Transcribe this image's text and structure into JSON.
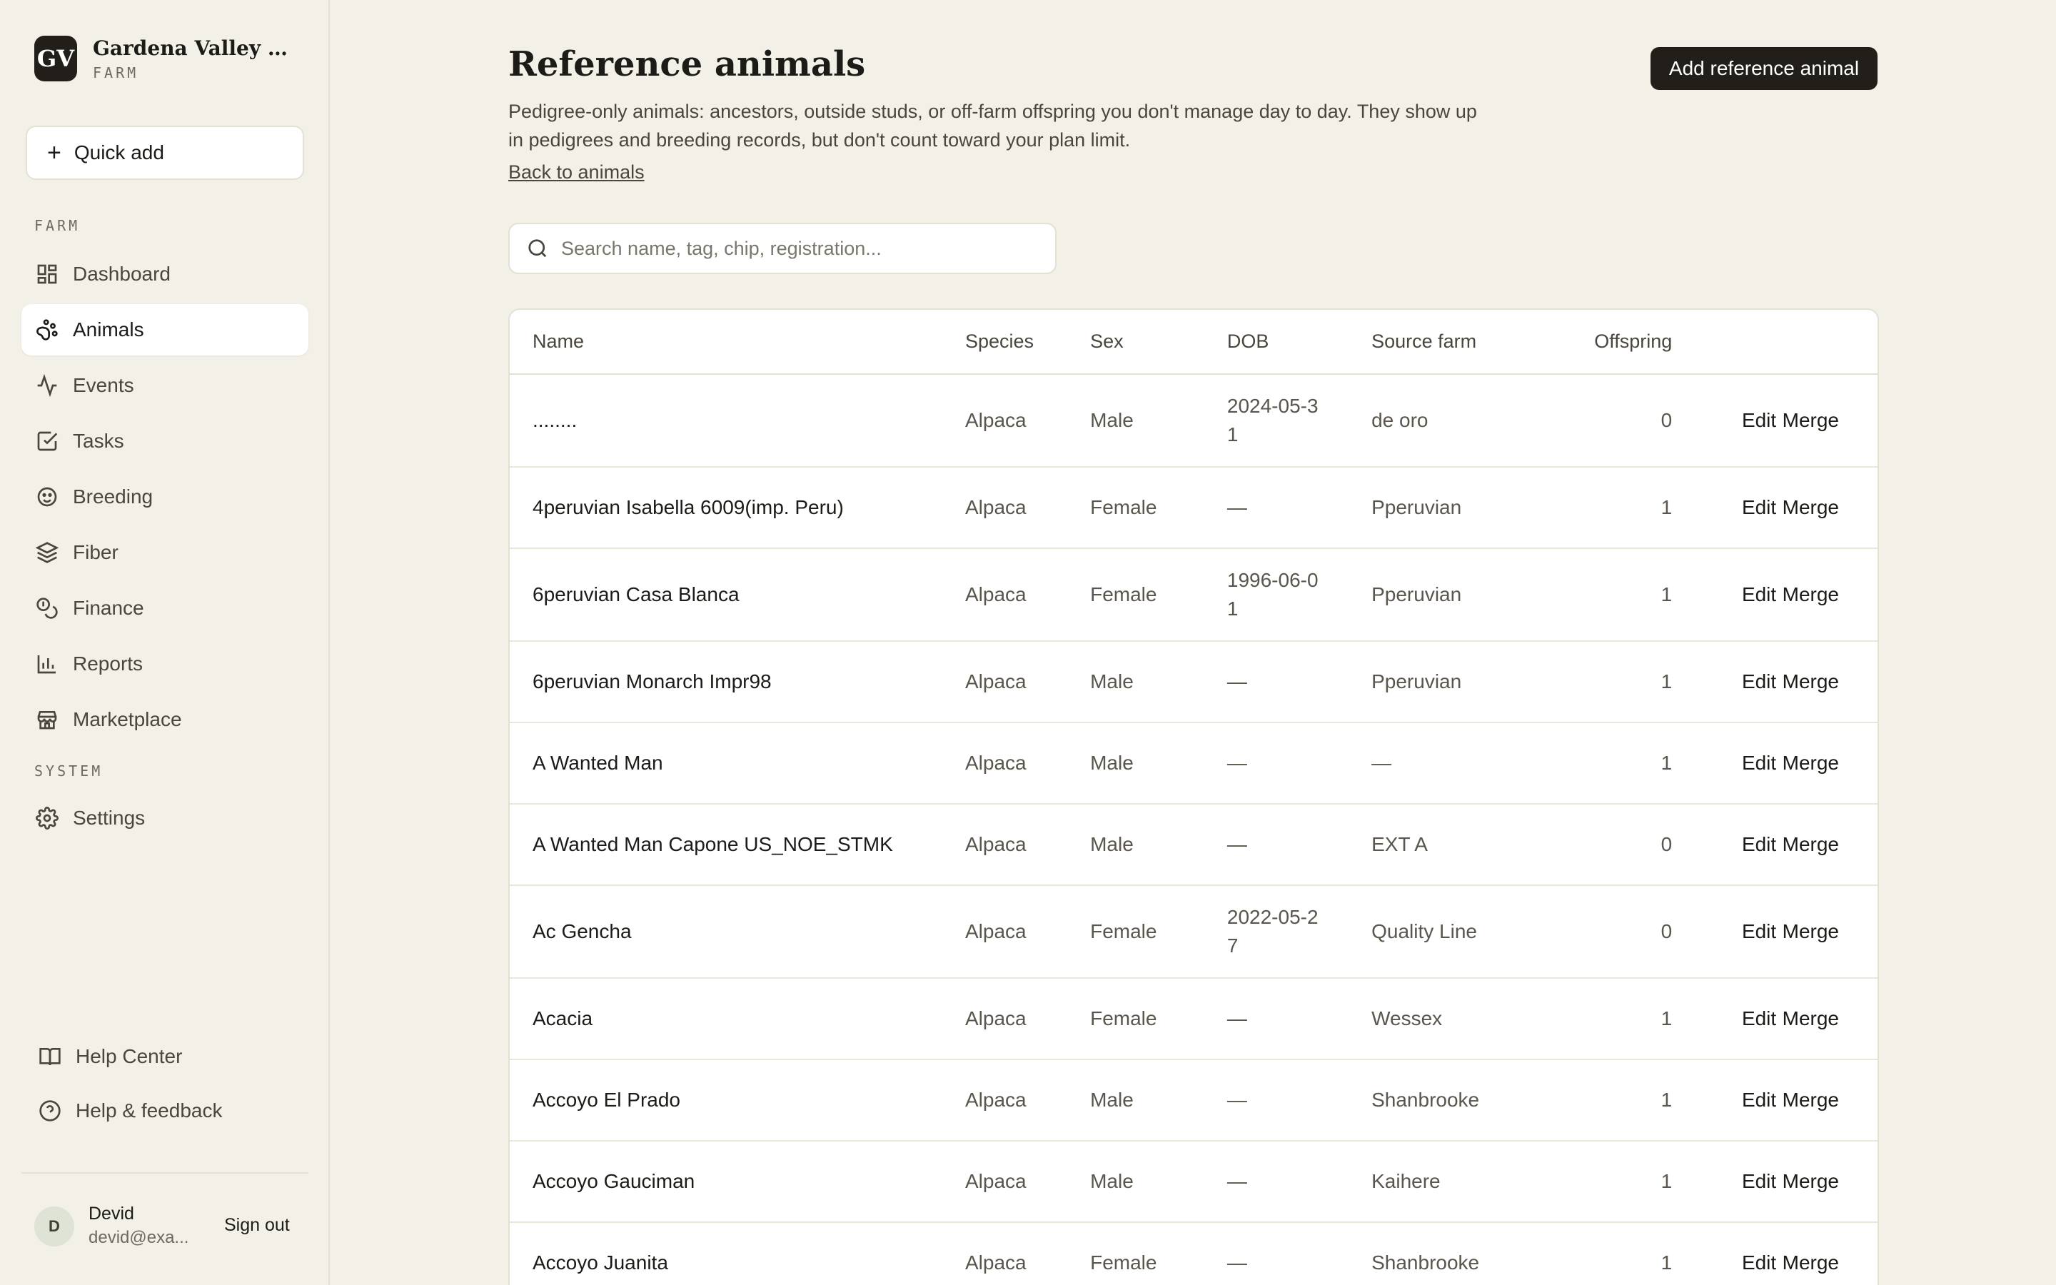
{
  "brand": {
    "initials": "GV",
    "name": "Gardena Valley Alp...",
    "sub": "FARM"
  },
  "quick_add": {
    "label": "Quick add"
  },
  "nav": {
    "farm_label": "FARM",
    "system_label": "SYSTEM",
    "items": [
      {
        "label": "Dashboard",
        "icon": "dashboard-icon"
      },
      {
        "label": "Animals",
        "icon": "paw-icon"
      },
      {
        "label": "Events",
        "icon": "activity-icon"
      },
      {
        "label": "Tasks",
        "icon": "checkbox-icon"
      },
      {
        "label": "Breeding",
        "icon": "breeding-icon"
      },
      {
        "label": "Fiber",
        "icon": "layers-icon"
      },
      {
        "label": "Finance",
        "icon": "coins-icon"
      },
      {
        "label": "Reports",
        "icon": "bar-chart-icon"
      },
      {
        "label": "Marketplace",
        "icon": "store-icon"
      }
    ],
    "settings": {
      "label": "Settings",
      "icon": "gear-icon"
    },
    "active": "Animals"
  },
  "footer": {
    "help_center": "Help Center",
    "help_feedback": "Help & feedback"
  },
  "user": {
    "initial": "D",
    "name": "Devid",
    "email": "devid@exa...",
    "sign_out": "Sign out"
  },
  "page": {
    "title": "Reference animals",
    "description": "Pedigree-only animals: ancestors, outside studs, or off-farm offspring you don't manage day to day. They show up in pedigrees and breeding records, but don't count toward your plan limit.",
    "back_link": "Back to animals",
    "add_button": "Add reference animal",
    "search_placeholder": "Search name, tag, chip, registration..."
  },
  "table": {
    "headers": {
      "name": "Name",
      "species": "Species",
      "sex": "Sex",
      "dob": "DOB",
      "source": "Source farm",
      "offspring": "Offspring"
    },
    "edit_label": "Edit",
    "merge_label": "Merge",
    "rows": [
      {
        "name": "........",
        "species": "Alpaca",
        "sex": "Male",
        "dob": "2024-05-31",
        "source": "de oro",
        "offspring": "0"
      },
      {
        "name": "4peruvian Isabella 6009(imp. Peru)",
        "species": "Alpaca",
        "sex": "Female",
        "dob": "—",
        "source": "Pperuvian",
        "offspring": "1"
      },
      {
        "name": "6peruvian Casa Blanca",
        "species": "Alpaca",
        "sex": "Female",
        "dob": "1996-06-01",
        "source": "Pperuvian",
        "offspring": "1"
      },
      {
        "name": "6peruvian Monarch Impr98",
        "species": "Alpaca",
        "sex": "Male",
        "dob": "—",
        "source": "Pperuvian",
        "offspring": "1"
      },
      {
        "name": "A Wanted Man",
        "species": "Alpaca",
        "sex": "Male",
        "dob": "—",
        "source": "—",
        "offspring": "1"
      },
      {
        "name": "A Wanted Man Capone US_NOE_STMK",
        "species": "Alpaca",
        "sex": "Male",
        "dob": "—",
        "source": "EXT A",
        "offspring": "0"
      },
      {
        "name": "Ac Gencha",
        "species": "Alpaca",
        "sex": "Female",
        "dob": "2022-05-27",
        "source": "Quality Line",
        "offspring": "0"
      },
      {
        "name": "Acacia",
        "species": "Alpaca",
        "sex": "Female",
        "dob": "—",
        "source": "Wessex",
        "offspring": "1"
      },
      {
        "name": "Accoyo El Prado",
        "species": "Alpaca",
        "sex": "Male",
        "dob": "—",
        "source": "Shanbrooke",
        "offspring": "1"
      },
      {
        "name": "Accoyo Gauciman",
        "species": "Alpaca",
        "sex": "Male",
        "dob": "—",
        "source": "Kaihere",
        "offspring": "1"
      },
      {
        "name": "Accoyo Juanita",
        "species": "Alpaca",
        "sex": "Female",
        "dob": "—",
        "source": "Shanbrooke",
        "offspring": "1"
      }
    ]
  }
}
